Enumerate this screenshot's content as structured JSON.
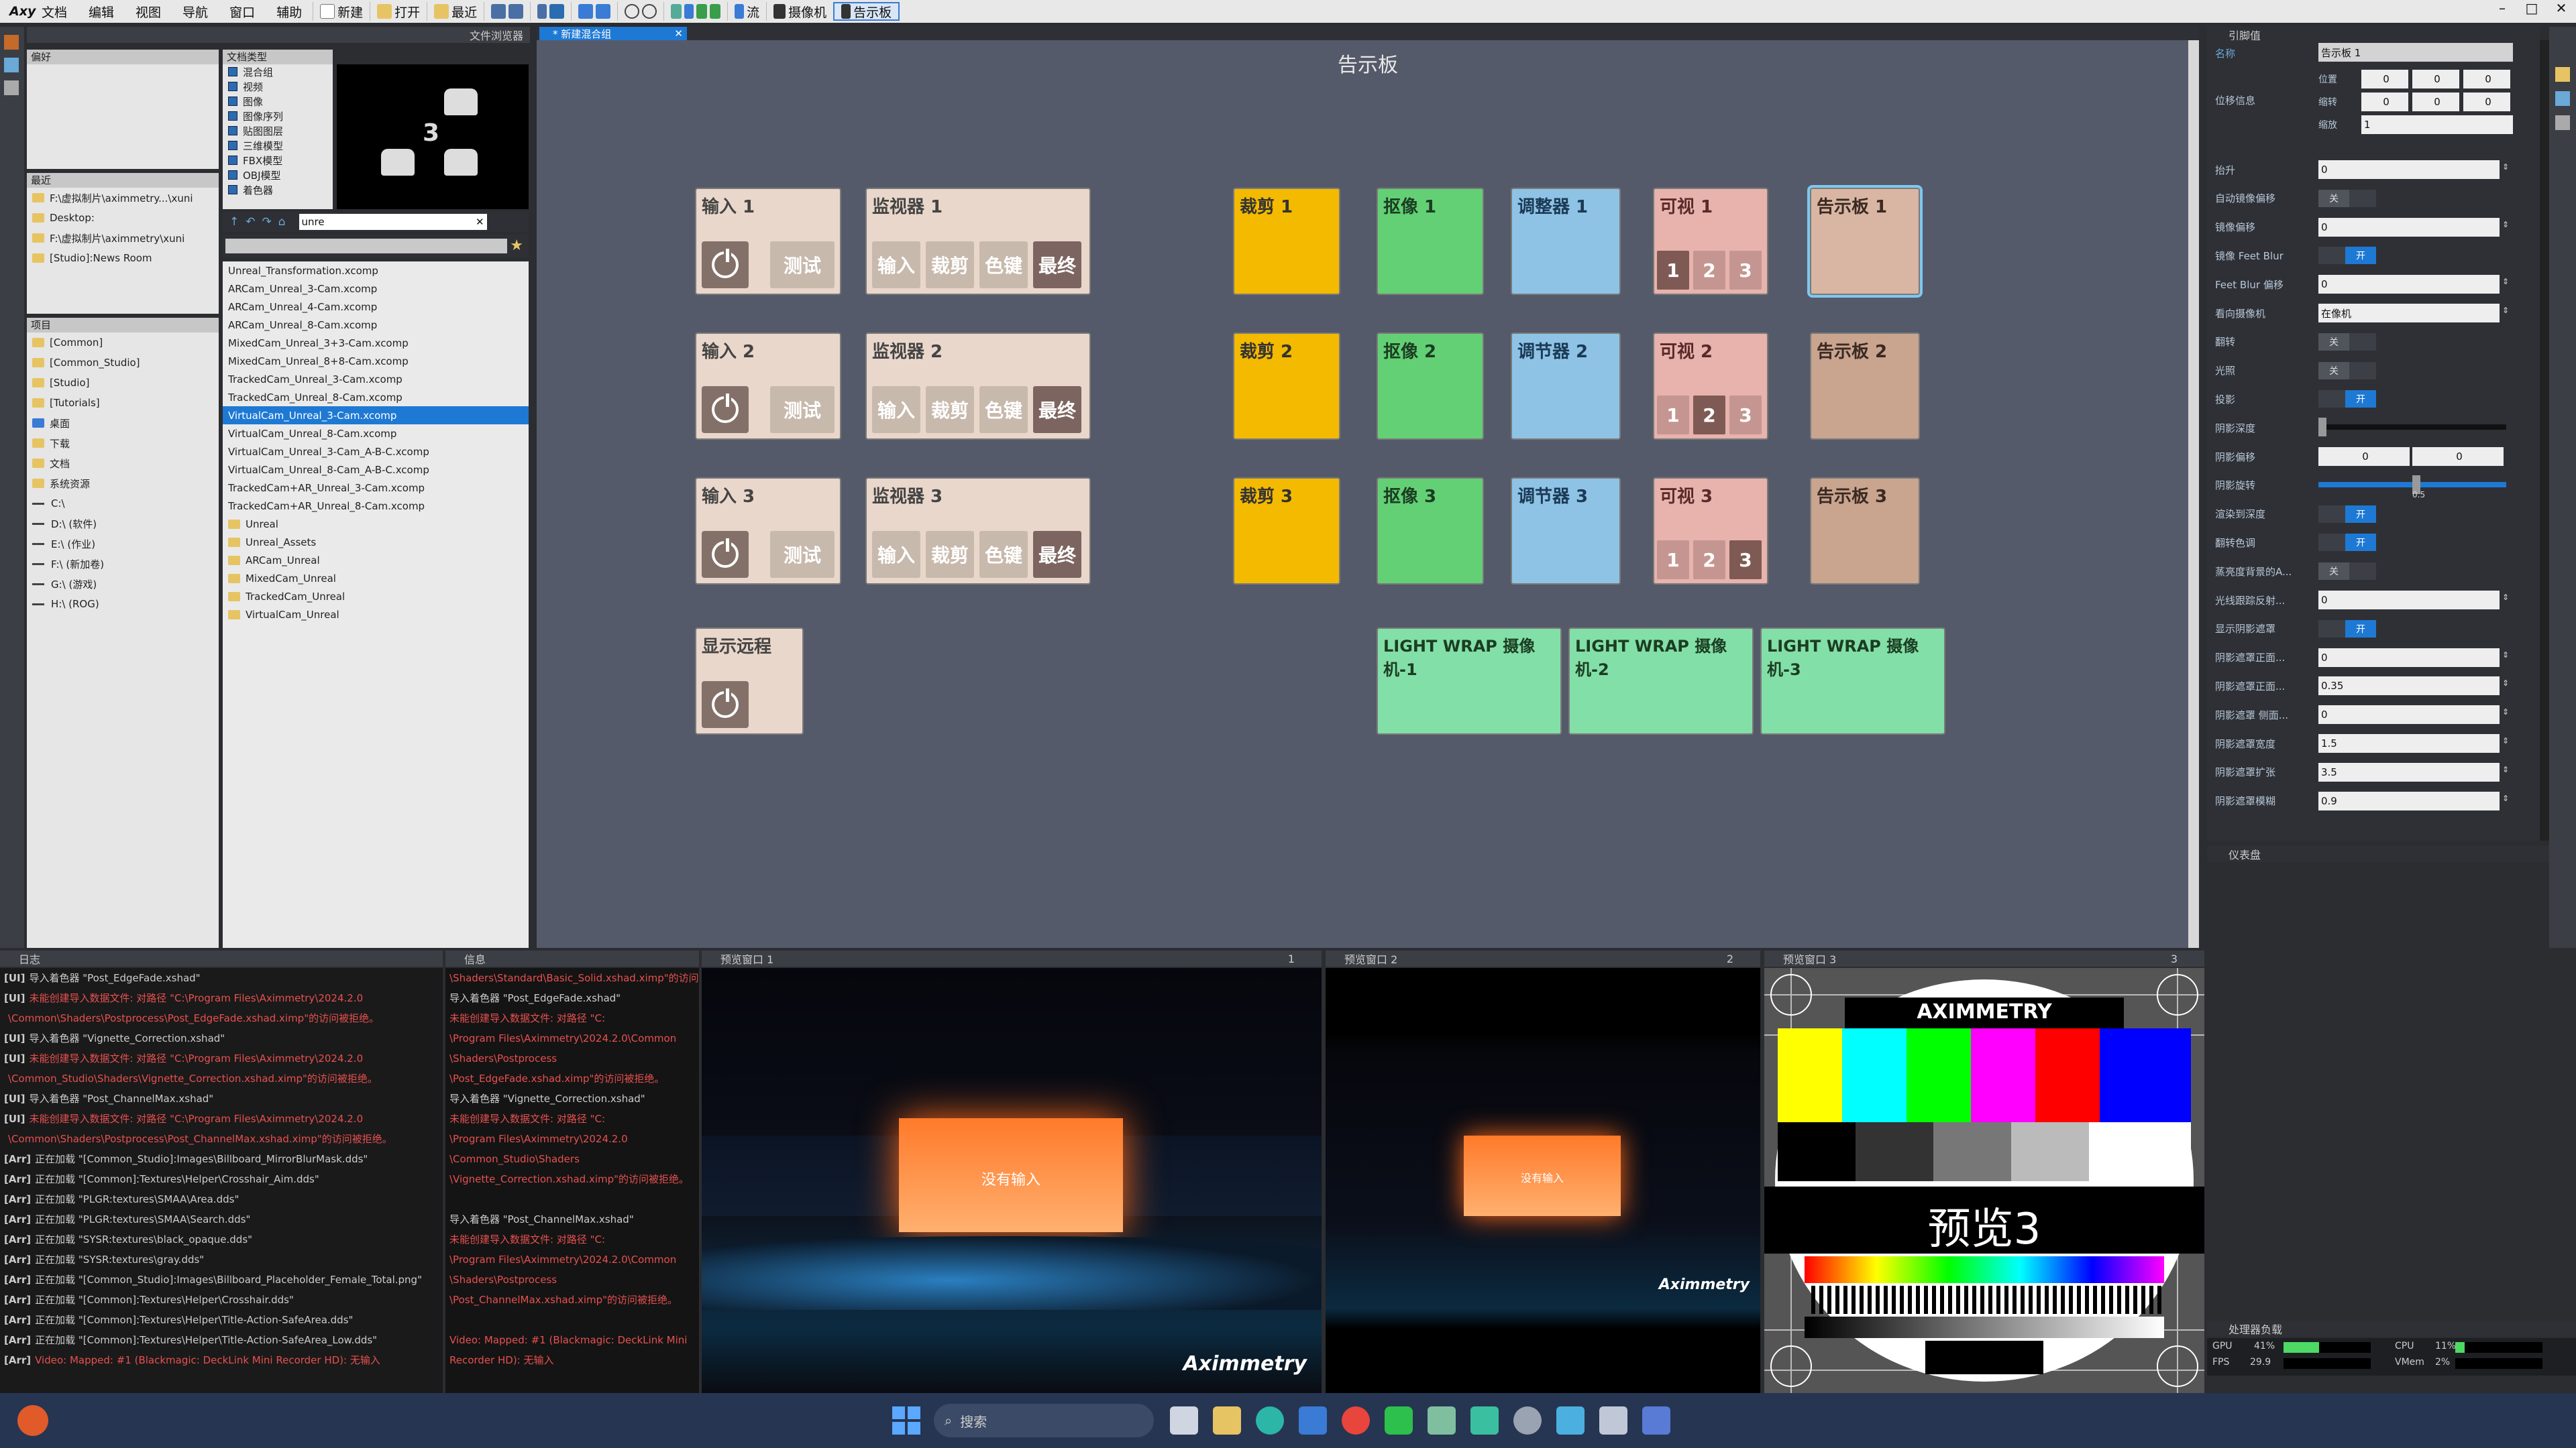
{
  "menu": {
    "logo": "Axy",
    "items": [
      "文档",
      "编辑",
      "视图",
      "导航",
      "窗口",
      "辅助"
    ],
    "toolbar": [
      "新建",
      "打开",
      "最近",
      "流",
      "摄像机",
      "告示板"
    ]
  },
  "left": {
    "explorer_title": "文件浏览器",
    "fav_label": "偏好",
    "recent_label": "最近",
    "project_label": "项目",
    "recent": [
      "F:\\虚拟制片\\aximmetry...\\xuni",
      "Desktop:",
      "F:\\虚拟制片\\aximmetry\\xuni",
      "[Studio]:News Room"
    ],
    "project": [
      "[Common]",
      "[Common_Studio]",
      "[Studio]",
      "[Tutorials]",
      "桌面",
      "下载",
      "文档",
      "系统资源",
      "C:\\",
      "D:\\ (软件)",
      "E:\\ (作业)",
      "F:\\ (新加卷)",
      "G:\\ (游戏)",
      "H:\\ (ROG)"
    ],
    "types_label": "文档类型",
    "types": [
      "混合组",
      "视频",
      "图像",
      "图像序列",
      "贴图图层",
      "三维模型",
      "FBX模型",
      "OBJ模型",
      "着色器"
    ],
    "search": "unre",
    "thumb_number": "3",
    "files": [
      "Unreal_Transformation.xcomp",
      "ARCam_Unreal_3-Cam.xcomp",
      "ARCam_Unreal_4-Cam.xcomp",
      "ARCam_Unreal_8-Cam.xcomp",
      "MixedCam_Unreal_3+3-Cam.xcomp",
      "MixedCam_Unreal_8+8-Cam.xcomp",
      "TrackedCam_Unreal_3-Cam.xcomp",
      "TrackedCam_Unreal_8-Cam.xcomp",
      "VirtualCam_Unreal_3-Cam.xcomp",
      "VirtualCam_Unreal_8-Cam.xcomp",
      "VirtualCam_Unreal_3-Cam_A-B-C.xcomp",
      "VirtualCam_Unreal_8-Cam_A-B-C.xcomp",
      "TrackedCam+AR_Unreal_3-Cam.xcomp",
      "TrackedCam+AR_Unreal_8-Cam.xcomp",
      "Unreal",
      "Unreal_Assets",
      "ARCam_Unreal",
      "MixedCam_Unreal",
      "TrackedCam_Unreal",
      "VirtualCam_Unreal"
    ]
  },
  "tab": "* 新建混合组",
  "board": {
    "title": "告示板",
    "inputs": [
      "输入 1",
      "输入 2",
      "输入 3"
    ],
    "test": "测试",
    "monitors": [
      "监视器 1",
      "监视器 2",
      "监视器 3"
    ],
    "mon_btns": [
      "输入",
      "裁剪",
      "色键",
      "最终"
    ],
    "remote": "显示远程",
    "crop": [
      "裁剪 1",
      "裁剪 2",
      "裁剪 3"
    ],
    "matte": [
      "抠像 1",
      "抠像 2",
      "抠像 3"
    ],
    "adjust": [
      "调整器 1",
      "调节器 2",
      "调节器 3"
    ],
    "visual": [
      "可视 1",
      "可视 2",
      "可视 3"
    ],
    "visual_nums": [
      "1",
      "2",
      "3"
    ],
    "billboard": [
      "告示板 1",
      "告示板 2",
      "告示板 3"
    ],
    "lightwrap": [
      "LIGHT WRAP 摄像机-1",
      "LIGHT WRAP 摄像机-2",
      "LIGHT WRAP 摄像机-3"
    ]
  },
  "props": {
    "title": "引脚值",
    "name_label": "名称",
    "name_value": "告示板 1",
    "xform_label": "位移信息",
    "xform_rows": [
      "位置",
      "缩转",
      "缩放"
    ],
    "zero": "0",
    "one": "1",
    "rows": [
      {
        "l": "抬升",
        "v": "0"
      },
      {
        "l": "自动镜像偏移",
        "t": "关"
      },
      {
        "l": "镜像偏移",
        "v": "0"
      },
      {
        "l": "镜像 Feet Blur",
        "t": "开"
      },
      {
        "l": "Feet Blur 偏移",
        "v": "0"
      },
      {
        "l": "看向摄像机",
        "v": "在像机"
      },
      {
        "l": "翻转",
        "t": "关"
      },
      {
        "l": "光照",
        "t": "关"
      },
      {
        "l": "投影",
        "t": "开"
      },
      {
        "l": "阴影深度",
        "v": ""
      },
      {
        "l": "阴影偏移",
        "v": "0"
      },
      {
        "l": "阴影旋转",
        "v": ""
      },
      {
        "l": "渲染到深度",
        "t": "开"
      },
      {
        "l": "翻转色调",
        "t": "开"
      },
      {
        "l": "蒸亮度背景的A...",
        "t": "关"
      },
      {
        "l": "光线跟踪反射...",
        "v": "0"
      },
      {
        "l": "显示阴影遮罩",
        "t": "开"
      },
      {
        "l": "阴影遮罩正面...",
        "v": "0"
      },
      {
        "l": "阴影遮罩正面...",
        "v": "0.35"
      },
      {
        "l": "阴影遮罩 侧面...",
        "v": "0"
      },
      {
        "l": "阴影遮罩宽度",
        "v": "1.5"
      },
      {
        "l": "阴影遮罩扩张",
        "v": "3.5"
      },
      {
        "l": "阴影遮罩模糊",
        "v": "0.9"
      }
    ],
    "slider_val": "0.5",
    "sub_title": "仪表盘",
    "perf_title": "处理器负载",
    "perf": {
      "gpu": "41%",
      "fps": "29.9",
      "cpu": "11%",
      "vmem": "2%",
      "gpu_l": "GPU",
      "fps_l": "FPS",
      "cpu_l": "CPU",
      "vmem_l": "VMem"
    }
  },
  "bottom": {
    "log_title": "日志",
    "info_title": "信息",
    "pv1": "预览窗口 1",
    "pv2": "预览窗口 2",
    "pv3": "预览窗口 3",
    "pv_nums": [
      "1",
      "2",
      "3"
    ],
    "log": [
      {
        "p": "[UI]",
        "t": "导入着色器 \"Post_EdgeFade.xshad\""
      },
      {
        "p": "[UI]",
        "t": "未能创建导入数据文件: 对路径 \"C:\\Program Files\\Aximmetry\\2024.2.0",
        "r": true
      },
      {
        "p": "",
        "t": "\\Common\\Shaders\\Postprocess\\Post_EdgeFade.xshad.ximp\"的访问被拒绝。",
        "r": true
      },
      {
        "p": "[UI]",
        "t": "导入着色器 \"Vignette_Correction.xshad\""
      },
      {
        "p": "[UI]",
        "t": "未能创建导入数据文件: 对路径 \"C:\\Program Files\\Aximmetry\\2024.2.0",
        "r": true
      },
      {
        "p": "",
        "t": "\\Common_Studio\\Shaders\\Vignette_Correction.xshad.ximp\"的访问被拒绝。",
        "r": true
      },
      {
        "p": "[UI]",
        "t": "导入着色器 \"Post_ChannelMax.xshad\""
      },
      {
        "p": "[UI]",
        "t": "未能创建导入数据文件: 对路径 \"C:\\Program Files\\Aximmetry\\2024.2.0",
        "r": true
      },
      {
        "p": "",
        "t": "\\Common\\Shaders\\Postprocess\\Post_ChannelMax.xshad.ximp\"的访问被拒绝。",
        "r": true
      },
      {
        "p": "[Arr]",
        "t": "正在加载 \"[Common_Studio]:Images\\Billboard_MirrorBlurMask.dds\""
      },
      {
        "p": "[Arr]",
        "t": "正在加载 \"[Common]:Textures\\Helper\\Crosshair_Aim.dds\""
      },
      {
        "p": "[Arr]",
        "t": "正在加载 \"PLGR:textures\\SMAA\\Area.dds\""
      },
      {
        "p": "[Arr]",
        "t": "正在加载 \"PLGR:textures\\SMAA\\Search.dds\""
      },
      {
        "p": "[Arr]",
        "t": "正在加载 \"SYSR:textures\\black_opaque.dds\""
      },
      {
        "p": "[Arr]",
        "t": "正在加载 \"SYSR:textures\\gray.dds\""
      },
      {
        "p": "[Arr]",
        "t": "正在加载 \"[Common_Studio]:Images\\Billboard_Placeholder_Female_Total.png\""
      },
      {
        "p": "[Arr]",
        "t": "正在加载 \"[Common]:Textures\\Helper\\Crosshair.dds\""
      },
      {
        "p": "[Arr]",
        "t": "正在加载 \"[Common]:Textures\\Helper\\Title-Action-SafeArea.dds\""
      },
      {
        "p": "[Arr]",
        "t": "正在加载 \"[Common]:Textures\\Helper\\Title-Action-SafeArea_Low.dds\""
      },
      {
        "p": "[Arr]",
        "t": "Video: Mapped: #1 (Blackmagic: DeckLink Mini Recorder HD): 无输入",
        "r": true
      }
    ],
    "info": [
      {
        "t": "\\Shaders\\Standard\\Basic_Solid.xshad.ximp\"的访问被拒绝。",
        "r": true
      },
      {
        "t": "导入着色器 \"Post_EdgeFade.xshad\""
      },
      {
        "t": "  未能创建导入数据文件: 对路径 \"C:",
        "r": true
      },
      {
        "t": "\\Program Files\\Aximmetry\\2024.2.0\\Common",
        "r": true
      },
      {
        "t": "\\Shaders\\Postprocess",
        "r": true
      },
      {
        "t": "\\Post_EdgeFade.xshad.ximp\"的访问被拒绝。",
        "r": true
      },
      {
        "t": "导入着色器 \"Vignette_Correction.xshad\""
      },
      {
        "t": "  未能创建导入数据文件: 对路径 \"C:",
        "r": true
      },
      {
        "t": "\\Program Files\\Aximmetry\\2024.2.0",
        "r": true
      },
      {
        "t": "\\Common_Studio\\Shaders",
        "r": true
      },
      {
        "t": "\\Vignette_Correction.xshad.ximp\"的访问被拒绝。",
        "r": true
      },
      {
        "t": ""
      },
      {
        "t": "导入着色器 \"Post_ChannelMax.xshad\""
      },
      {
        "t": "  未能创建导入数据文件: 对路径 \"C:",
        "r": true
      },
      {
        "t": "\\Program Files\\Aximmetry\\2024.2.0\\Common",
        "r": true
      },
      {
        "t": "\\Shaders\\Postprocess",
        "r": true
      },
      {
        "t": "\\Post_ChannelMax.xshad.ximp\"的访问被拒绝。",
        "r": true
      },
      {
        "t": ""
      },
      {
        "t": "Video: Mapped: #1 (Blackmagic: DeckLink Mini",
        "r": true
      },
      {
        "t": "Recorder HD): 无输入",
        "r": true
      }
    ],
    "no_input": "没有输入",
    "brand": "Aximmetry",
    "pv3_brand": "AXIMMETRY",
    "pv3_text": "预览3"
  },
  "taskbar": {
    "search": "搜索"
  }
}
